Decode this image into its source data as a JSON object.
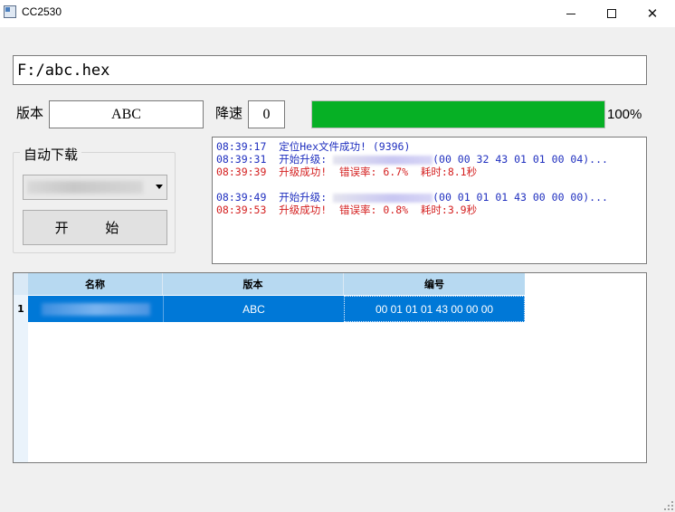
{
  "window": {
    "title": "CC2530",
    "controls": {
      "minimize": "",
      "maximize": "",
      "close": "✕"
    }
  },
  "file_path": "F:/abc.hex",
  "version": {
    "label": "版本",
    "value": "ABC"
  },
  "speed": {
    "label": "降速",
    "value": "0"
  },
  "progress": {
    "percent": 100,
    "text": "100%",
    "color": "#06b025"
  },
  "auto_download": {
    "title": "自动下载",
    "start_label": "开 始"
  },
  "log": [
    {
      "time": "08:39:17",
      "text": "  定位Hex文件成功! (9396)",
      "color": "blue"
    },
    {
      "time": "08:39:31",
      "text": "  开始升级: ",
      "redacted": true,
      "tail": "(00 00 32 43 01 01 00 04)...",
      "color": "blue"
    },
    {
      "time": "08:39:39",
      "text": "  升级成功!  错误率: 6.7%  耗时:8.1秒",
      "color": "red"
    },
    {
      "time": "",
      "text": "",
      "color": "blue"
    },
    {
      "time": "08:39:49",
      "text": "  开始升级: ",
      "redacted": true,
      "tail": "(00 01 01 01 43 00 00 00)...",
      "color": "blue"
    },
    {
      "time": "08:39:53",
      "text": "  升级成功!  错误率: 0.8%  耗时:3.9秒",
      "color": "red"
    }
  ],
  "table": {
    "headers": [
      "名称",
      "版本",
      "编号"
    ],
    "rows": [
      {
        "num": "1",
        "name": "",
        "version": "ABC",
        "code": "00 01 01 01 43 00 00 00"
      }
    ]
  }
}
